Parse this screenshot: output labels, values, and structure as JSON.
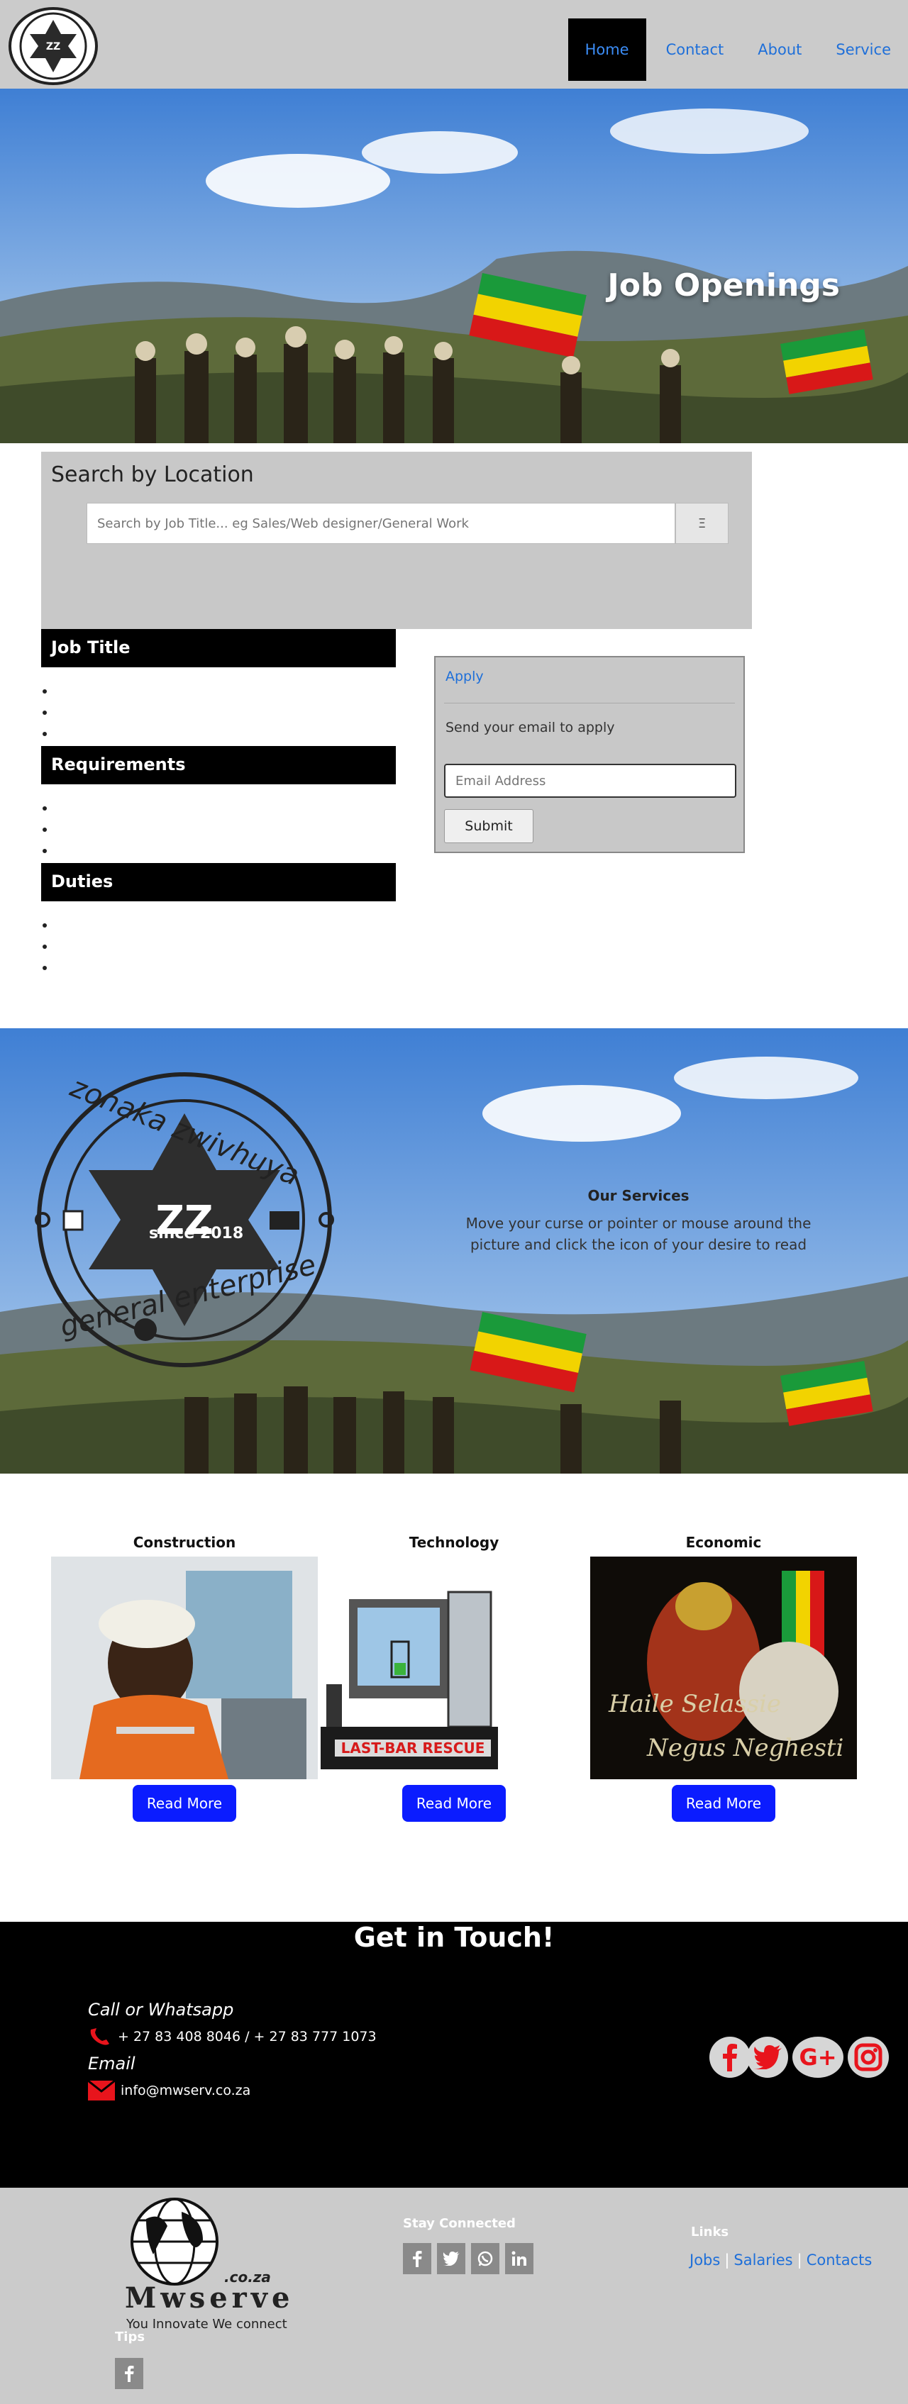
{
  "nav": {
    "logo_text_top": "zonaka zwivhuya",
    "logo_text_bottom": "general enterprise",
    "links": [
      "Home",
      "Contact",
      "About",
      "Service"
    ]
  },
  "hero": {
    "title": "Job Openings"
  },
  "search": {
    "heading": "Search by Location",
    "placeholder": "Search by Job Title... eg Sales/Web designer/General Work",
    "button_icon": "Ξ"
  },
  "job": {
    "title_heading": "Job Title",
    "requirements_heading": "Requirements",
    "duties_heading": "Duties"
  },
  "apply": {
    "link": "Apply",
    "text": "Send your email to apply",
    "email_placeholder": "Email Address",
    "submit": "Submit"
  },
  "banner": {
    "logo_top": "zonaka zwivhuya",
    "logo_bottom": "general enterprise",
    "logo_since": "since 2018",
    "title": "Our Services",
    "desc": "Move your curse or pointer or mouse around the picture and click the icon of your desire to read"
  },
  "services": [
    {
      "title": "Construction",
      "button": "Read More"
    },
    {
      "title": "Technology",
      "button": "Read More",
      "image_text": "LAST-BAR RESCUE"
    },
    {
      "title": "Economic",
      "button": "Read More",
      "image_text_1": "Haile Selassie",
      "image_text_2": "Negus Neghesti"
    }
  ],
  "touch": {
    "title": "Get in Touch!",
    "call_label": "Call or Whatsapp",
    "phone": "+ 27 83 408 8046 / + 27 83 777 1073",
    "email_label": "Email",
    "email": "info@mwserv.co.za"
  },
  "footer": {
    "brand": "Mwserve",
    "brand_suffix": ".co.za",
    "tagline": "You Innovate We connect",
    "stay_connected": "Stay Connected",
    "links_heading": "Links",
    "links": [
      "Jobs",
      "Salaries",
      "Contacts"
    ],
    "tips": "Tips"
  },
  "colors": {
    "nav_bg": "#cbcbcb",
    "link": "#1e6fd9",
    "button_blue": "#0b1cff",
    "icon_red": "#e8141c"
  }
}
